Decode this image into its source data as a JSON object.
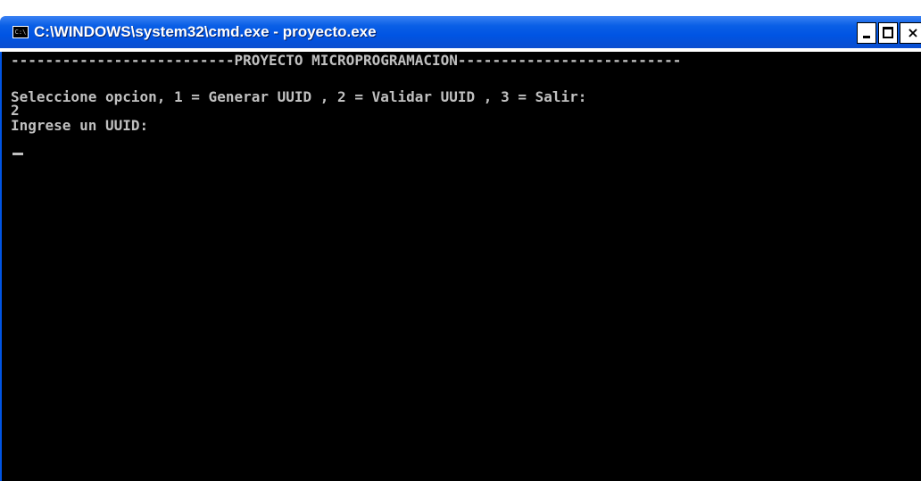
{
  "window": {
    "title": "C:\\WINDOWS\\system32\\cmd.exe - proyecto.exe",
    "icon_text": "C:\\",
    "icon": "console-icon",
    "controls": {
      "minimize_icon": "minimize-icon",
      "maximize_icon": "maximize-icon",
      "close_label": "×"
    }
  },
  "console": {
    "background": "#000000",
    "foreground": "#c0c0c0",
    "lines": [
      "--------------------------PROYECTO MICROPROGRAMACION--------------------------",
      "Seleccione opcion, 1 = Generar UUID , 2 = Validar UUID , 3 = Salir:",
      "2",
      "Ingrese un UUID:"
    ]
  },
  "colors": {
    "titlebar": "#0054e3",
    "title_text": "#ffffff"
  }
}
